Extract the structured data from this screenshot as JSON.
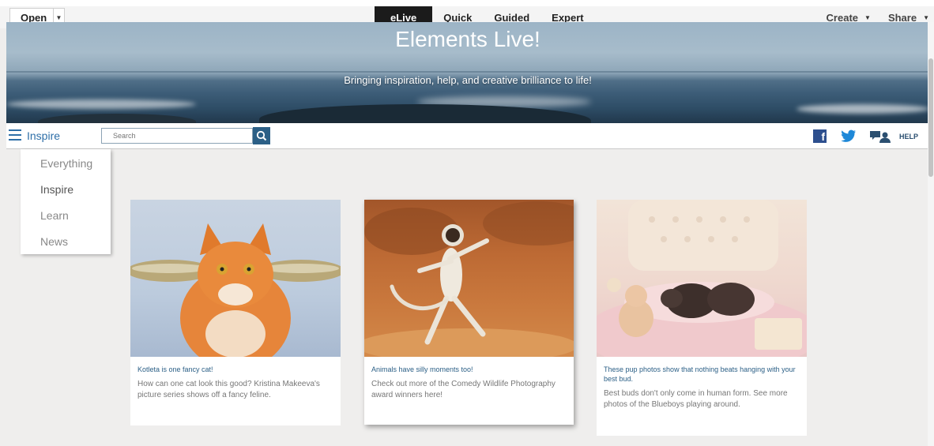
{
  "topbar": {
    "open_label": "Open",
    "tabs": [
      {
        "label": "eLive"
      },
      {
        "label": "Quick"
      },
      {
        "label": "Guided"
      },
      {
        "label": "Expert"
      }
    ],
    "create_label": "Create",
    "share_label": "Share"
  },
  "hero": {
    "title": "Elements Live!",
    "subtitle": "Bringing inspiration, help, and creative brilliance to life!"
  },
  "nav": {
    "category_label": "Inspire",
    "search_placeholder": "Search",
    "help_label": "HELP",
    "menu_items": [
      {
        "label": "Everything"
      },
      {
        "label": "Inspire"
      },
      {
        "label": "Learn"
      },
      {
        "label": "News"
      }
    ]
  },
  "cards": [
    {
      "title": "Kotleta is one fancy cat!",
      "description": "How can one cat look this good? Kristina Makeeva's picture series shows off a fancy feline."
    },
    {
      "title": "Animals have silly moments too!",
      "description": "Check out more of the Comedy Wildlife Photography award winners here!"
    },
    {
      "title": "These pup photos show that nothing beats hanging with your best bud.",
      "description": "Best buds don't only come in human form. See more photos of the Blueboys playing around."
    }
  ]
}
